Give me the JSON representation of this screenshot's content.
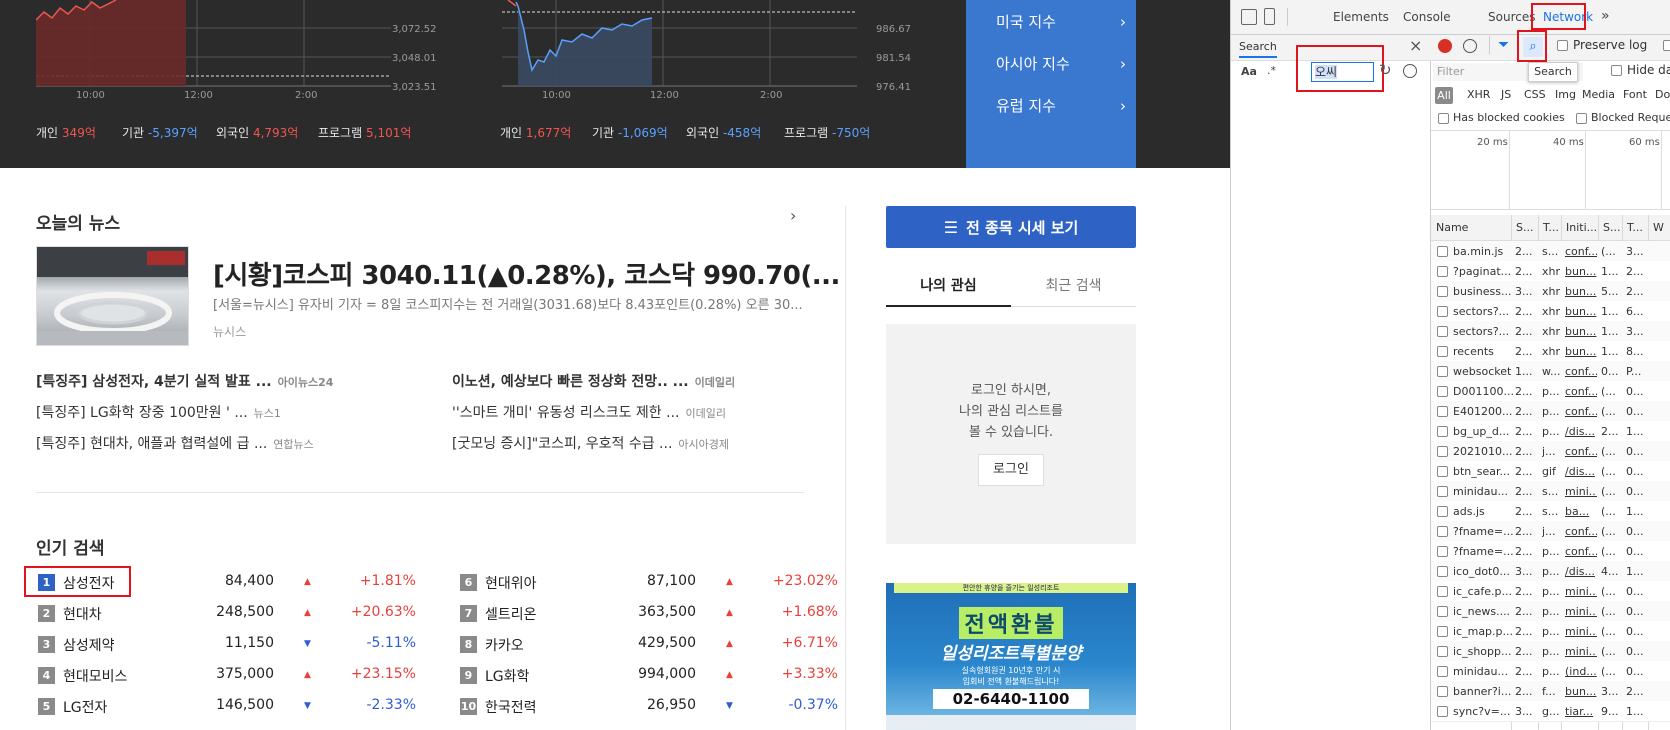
{
  "market": {
    "chart1": {
      "yticks": [
        "3,072.52",
        "3,048.01",
        "3,023.51"
      ],
      "xticks": [
        "10:00",
        "12:00",
        "2:00"
      ],
      "flows": [
        {
          "label": "개인",
          "value": "349억",
          "dir": "up"
        },
        {
          "label": "기관",
          "value": "-5,397억",
          "dir": "down"
        },
        {
          "label": "외국인",
          "value": "4,793억",
          "dir": "up"
        },
        {
          "label": "프로그램",
          "value": "5,101억",
          "dir": "up"
        }
      ]
    },
    "chart2": {
      "yticks": [
        "986.67",
        "981.54",
        "976.41"
      ],
      "xticks": [
        "10:00",
        "12:00",
        "2:00"
      ],
      "flows": [
        {
          "label": "개인",
          "value": "1,677억",
          "dir": "up"
        },
        {
          "label": "기관",
          "value": "-1,069억",
          "dir": "down"
        },
        {
          "label": "외국인",
          "value": "-458억",
          "dir": "down"
        },
        {
          "label": "프로그램",
          "value": "-750억",
          "dir": "down"
        }
      ]
    },
    "indices": [
      "미국 지수",
      "아시아 지수",
      "유럽 지수"
    ]
  },
  "news": {
    "section_title": "오늘의 뉴스",
    "headline": "[시황]코스피 3040.11(▲0.28%), 코스닥 990.70(...",
    "summary": "[서울=뉴시스] 유자비 기자 = 8일 코스피지수는 전 거래일(3031.68)보다 8.43포인트(0.28%) 오른 30...",
    "source": "뉴시스",
    "items": [
      {
        "title": "[특징주] 삼성전자, 4분기 실적 발표 ...",
        "source": "아이뉴스24",
        "bold": true
      },
      {
        "title": "이노션, 예상보다 빠른 정상화 전망.. ...",
        "source": "이데일리",
        "bold": true
      },
      {
        "title": "[특징주] LG화학 장중 100만원 ' ...",
        "source": "뉴스1",
        "bold": false
      },
      {
        "title": "''스마트 개미' 유동성 리스크도 제한 ...",
        "source": "이데일리",
        "bold": false
      },
      {
        "title": "[특징주] 현대차, 애플과 협력설에 급 ...",
        "source": "연합뉴스",
        "bold": false
      },
      {
        "title": "[굿모닝 증시]\"코스피, 우호적 수급 ...",
        "source": "아시아경제",
        "bold": false
      }
    ]
  },
  "popular": {
    "title": "인기 검색",
    "items": [
      {
        "rank": "1",
        "name": "삼성전자",
        "price": "84,400",
        "dir": "up",
        "change": "+1.81%"
      },
      {
        "rank": "2",
        "name": "현대차",
        "price": "248,500",
        "dir": "up",
        "change": "+20.63%"
      },
      {
        "rank": "3",
        "name": "삼성제약",
        "price": "11,150",
        "dir": "down",
        "change": "-5.11%"
      },
      {
        "rank": "4",
        "name": "현대모비스",
        "price": "375,000",
        "dir": "up",
        "change": "+23.15%"
      },
      {
        "rank": "5",
        "name": "LG전자",
        "price": "146,500",
        "dir": "down",
        "change": "-2.33%"
      },
      {
        "rank": "6",
        "name": "현대위아",
        "price": "87,100",
        "dir": "up",
        "change": "+23.02%"
      },
      {
        "rank": "7",
        "name": "셀트리온",
        "price": "363,500",
        "dir": "up",
        "change": "+1.68%"
      },
      {
        "rank": "8",
        "name": "카카오",
        "price": "429,500",
        "dir": "up",
        "change": "+6.71%"
      },
      {
        "rank": "9",
        "name": "LG화학",
        "price": "994,000",
        "dir": "up",
        "change": "+3.33%"
      },
      {
        "rank": "10",
        "name": "한국전력",
        "price": "26,950",
        "dir": "down",
        "change": "-0.37%"
      }
    ]
  },
  "side": {
    "all_stocks_button": "전 종목 시세 보기",
    "tabs": [
      "나의 관심",
      "최근 검색"
    ],
    "login_message": [
      "로그인 하시면,",
      "나의 관심 리스트를",
      "볼 수 있습니다."
    ],
    "login_button": "로그인",
    "ad": {
      "top": "편안한 휴양을 즐기는 일성리조트",
      "big": "전액환불",
      "sub": "일성리조트특별분양",
      "line1": "실속형회원권 10년후 만기 시",
      "line2": "입회비 전액 환불해드립니다!",
      "phone": "02-6440-1100"
    }
  },
  "devtools": {
    "tabs": [
      "Elements",
      "Console",
      "Sources",
      "Network"
    ],
    "more": "»",
    "search_tab": "Search",
    "search_value": "오씨",
    "aa": "Aa",
    "star": ".*",
    "tooltip": "Search",
    "preserve_log": "Preserve log",
    "filter_placeholder": "Filter",
    "hide_data": "Hide da",
    "types": [
      "All",
      "XHR",
      "JS",
      "CSS",
      "Img",
      "Media",
      "Font",
      "Do"
    ],
    "has_blocked": "Has blocked cookies",
    "blocked_req": "Blocked Reque",
    "timeline": [
      "20 ms",
      "40 ms",
      "60 ms"
    ],
    "columns": [
      "Name",
      "S...",
      "T...",
      "Initi...",
      "S...",
      "T...",
      "W"
    ],
    "rows": [
      {
        "name": "ba.min.js",
        "s": "2...",
        "t": "s...",
        "i": "conf...",
        "sz": "(...",
        "tm": "3..."
      },
      {
        "name": "?paginat...",
        "s": "2...",
        "t": "xhr",
        "i": "bun...",
        "sz": "1...",
        "tm": "2..."
      },
      {
        "name": "business...",
        "s": "3...",
        "t": "xhr",
        "i": "bun...",
        "sz": "5...",
        "tm": "2..."
      },
      {
        "name": "sectors?...",
        "s": "2...",
        "t": "xhr",
        "i": "bun...",
        "sz": "1...",
        "tm": "6..."
      },
      {
        "name": "sectors?...",
        "s": "2...",
        "t": "xhr",
        "i": "bun...",
        "sz": "1...",
        "tm": "3..."
      },
      {
        "name": "recents",
        "s": "2...",
        "t": "xhr",
        "i": "bun...",
        "sz": "1...",
        "tm": "8..."
      },
      {
        "name": "websocket",
        "s": "1...",
        "t": "w...",
        "i": "conf...",
        "sz": "0...",
        "tm": "P..."
      },
      {
        "name": "D001100...",
        "s": "2...",
        "t": "p...",
        "i": "conf...",
        "sz": "(...",
        "tm": "0..."
      },
      {
        "name": "E401200...",
        "s": "2...",
        "t": "p...",
        "i": "conf...",
        "sz": "(...",
        "tm": "0..."
      },
      {
        "name": "bg_up_d...",
        "s": "2...",
        "t": "p...",
        "i": "/dis...",
        "sz": "2...",
        "tm": "1..."
      },
      {
        "name": "2021010...",
        "s": "2...",
        "t": "j...",
        "i": "conf...",
        "sz": "(...",
        "tm": "0..."
      },
      {
        "name": "btn_sear...",
        "s": "2...",
        "t": "gif",
        "i": "/dis...",
        "sz": "(...",
        "tm": "0..."
      },
      {
        "name": "minidau...",
        "s": "2...",
        "t": "s...",
        "i": "mini...",
        "sz": "(...",
        "tm": "0..."
      },
      {
        "name": "ads.js",
        "s": "2...",
        "t": "s...",
        "i": "ba...",
        "sz": "(...",
        "tm": "1..."
      },
      {
        "name": "?fname=...",
        "s": "2...",
        "t": "j...",
        "i": "conf...",
        "sz": "(...",
        "tm": "0..."
      },
      {
        "name": "?fname=...",
        "s": "2...",
        "t": "p...",
        "i": "conf...",
        "sz": "(...",
        "tm": "0..."
      },
      {
        "name": "ico_dot0...",
        "s": "3...",
        "t": "p...",
        "i": "/dis...",
        "sz": "4...",
        "tm": "1..."
      },
      {
        "name": "ic_cafe.p...",
        "s": "2...",
        "t": "p...",
        "i": "mini...",
        "sz": "(...",
        "tm": "0..."
      },
      {
        "name": "ic_news....",
        "s": "2...",
        "t": "p...",
        "i": "mini...",
        "sz": "(...",
        "tm": "0..."
      },
      {
        "name": "ic_map.p...",
        "s": "2...",
        "t": "p...",
        "i": "mini...",
        "sz": "(...",
        "tm": "0..."
      },
      {
        "name": "ic_shopp...",
        "s": "2...",
        "t": "p...",
        "i": "mini...",
        "sz": "(...",
        "tm": "0..."
      },
      {
        "name": "minidau...",
        "s": "2...",
        "t": "p...",
        "i": "(ind...",
        "sz": "(...",
        "tm": "0..."
      },
      {
        "name": "banner?i...",
        "s": "2...",
        "t": "f...",
        "i": "bun...",
        "sz": "3...",
        "tm": "2..."
      },
      {
        "name": "sync?v=...",
        "s": "3...",
        "t": "g...",
        "i": "tiar...",
        "sz": "9...",
        "tm": "1..."
      }
    ]
  }
}
